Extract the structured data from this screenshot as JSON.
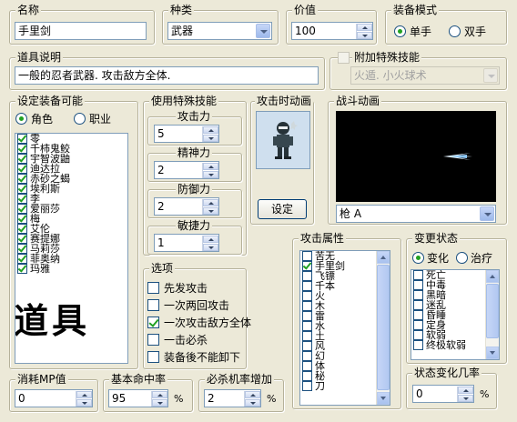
{
  "name": {
    "label": "名称",
    "value": "手里剑"
  },
  "category": {
    "label": "种类",
    "value": "武器"
  },
  "price": {
    "label": "价值",
    "value": "100"
  },
  "equip_mode": {
    "label": "装备模式",
    "options": [
      "单手",
      "双手"
    ],
    "selected": 0
  },
  "description": {
    "label": "道具说明",
    "value": "一般的忍者武器. 攻击敌方全体."
  },
  "extra_skill": {
    "label": "附加特殊技能",
    "value": "火遁. 小火球术",
    "checked": false
  },
  "equippable": {
    "label": "设定装备可能",
    "options": [
      "角色",
      "职业"
    ],
    "selected": 0,
    "items": [
      {
        "name": "零",
        "checked": true
      },
      {
        "name": "千柿鬼鲛",
        "checked": true
      },
      {
        "name": "宇智波鼬",
        "checked": true
      },
      {
        "name": "迪达拉",
        "checked": true
      },
      {
        "name": "赤砂之蝎",
        "checked": true
      },
      {
        "name": "埃利斯",
        "checked": true
      },
      {
        "name": "李",
        "checked": true
      },
      {
        "name": "爱丽莎",
        "checked": true
      },
      {
        "name": "梅",
        "checked": true
      },
      {
        "name": "艾伦",
        "checked": true
      },
      {
        "name": "赛提娜",
        "checked": true
      },
      {
        "name": "马莉莎",
        "checked": true
      },
      {
        "name": "菲奥纳",
        "checked": true
      },
      {
        "name": "玛雅",
        "checked": true
      }
    ],
    "watermark": "道具"
  },
  "special_skills": {
    "label": "使用特殊技能",
    "stats": [
      {
        "label": "攻击力",
        "value": "5"
      },
      {
        "label": "精神力",
        "value": "2"
      },
      {
        "label": "防御力",
        "value": "2"
      },
      {
        "label": "敏捷力",
        "value": "1"
      }
    ]
  },
  "attack_animation": {
    "label": "攻击时动画",
    "button": "设定"
  },
  "battle_animation": {
    "label": "战斗动画",
    "value": "枪 A"
  },
  "options": {
    "label": "选项",
    "items": [
      {
        "label": "先发攻击",
        "checked": false
      },
      {
        "label": "一次两回攻击",
        "checked": false
      },
      {
        "label": "一次攻击敌方全体",
        "checked": true
      },
      {
        "label": "一击必杀",
        "checked": false
      },
      {
        "label": "装备後不能卸下",
        "checked": false
      }
    ]
  },
  "attack_attributes": {
    "label": "攻击属性",
    "items": [
      {
        "name": "苦无",
        "checked": false
      },
      {
        "name": "手里剑",
        "checked": true
      },
      {
        "name": "飞镖",
        "checked": false
      },
      {
        "name": "千本",
        "checked": false
      },
      {
        "name": "火",
        "checked": false
      },
      {
        "name": "木",
        "checked": false
      },
      {
        "name": "雷",
        "checked": false
      },
      {
        "name": "水",
        "checked": false
      },
      {
        "name": "土",
        "checked": false
      },
      {
        "name": "风",
        "checked": false
      },
      {
        "name": "幻",
        "checked": false
      },
      {
        "name": "体",
        "checked": false
      },
      {
        "name": "秘",
        "checked": false
      },
      {
        "name": "刀",
        "checked": false
      }
    ]
  },
  "state_change": {
    "label": "变更状态",
    "options": [
      "变化",
      "治疗"
    ],
    "selected": 0,
    "items": [
      {
        "name": "死亡",
        "checked": false
      },
      {
        "name": "中毒",
        "checked": false
      },
      {
        "name": "黑暗",
        "checked": false
      },
      {
        "name": "迷乱",
        "checked": false
      },
      {
        "name": "昏睡",
        "checked": false
      },
      {
        "name": "定身",
        "checked": false
      },
      {
        "name": "软弱",
        "checked": false
      },
      {
        "name": "终极软弱",
        "checked": false
      }
    ]
  },
  "mp_cost": {
    "label": "消耗MP值",
    "value": "0"
  },
  "hit_rate": {
    "label": "基本命中率",
    "value": "95",
    "unit": "%"
  },
  "crit_bonus": {
    "label": "必杀机率增加",
    "value": "2",
    "unit": "%"
  },
  "state_chance": {
    "label": "状态变化几率",
    "value": "0",
    "unit": "%"
  }
}
